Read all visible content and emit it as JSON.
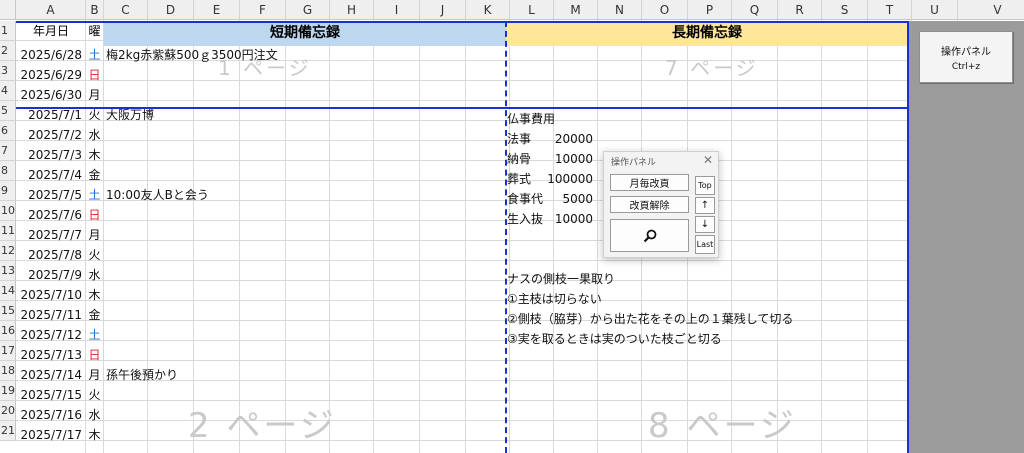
{
  "columns": [
    "A",
    "B",
    "C",
    "D",
    "E",
    "F",
    "G",
    "H",
    "I",
    "J",
    "K",
    "L",
    "M",
    "N",
    "O",
    "P",
    "Q",
    "R",
    "S",
    "T",
    "U",
    "V"
  ],
  "rows": [
    "1",
    "2",
    "3",
    "4",
    "5",
    "6",
    "7",
    "8",
    "9",
    "10",
    "11",
    "12",
    "13",
    "14",
    "15",
    "16",
    "17",
    "18",
    "19",
    "20",
    "21"
  ],
  "header": {
    "date_label": "年月日",
    "dow_label": "曜",
    "short_term_title": "短期備忘録",
    "long_term_title": "長期備忘録",
    "short_color": "#bdd7ee",
    "long_color": "#ffe699"
  },
  "days": [
    {
      "date": "2025/6/28",
      "dow": "土",
      "dow_color": "#1f6fd1",
      "memo": "梅2kg赤紫蘇500ｇ3500円注文"
    },
    {
      "date": "2025/6/29",
      "dow": "日",
      "dow_color": "#e0202a",
      "memo": ""
    },
    {
      "date": "2025/6/30",
      "dow": "月",
      "dow_color": "#111111",
      "memo": ""
    },
    {
      "date": "2025/7/1",
      "dow": "火",
      "dow_color": "#111111",
      "memo": "大阪万博"
    },
    {
      "date": "2025/7/2",
      "dow": "水",
      "dow_color": "#111111",
      "memo": ""
    },
    {
      "date": "2025/7/3",
      "dow": "木",
      "dow_color": "#111111",
      "memo": ""
    },
    {
      "date": "2025/7/4",
      "dow": "金",
      "dow_color": "#111111",
      "memo": ""
    },
    {
      "date": "2025/7/5",
      "dow": "土",
      "dow_color": "#1f6fd1",
      "memo": "10:00友人Bと会う"
    },
    {
      "date": "2025/7/6",
      "dow": "日",
      "dow_color": "#e0202a",
      "memo": ""
    },
    {
      "date": "2025/7/7",
      "dow": "月",
      "dow_color": "#111111",
      "memo": ""
    },
    {
      "date": "2025/7/8",
      "dow": "火",
      "dow_color": "#111111",
      "memo": ""
    },
    {
      "date": "2025/7/9",
      "dow": "水",
      "dow_color": "#111111",
      "memo": ""
    },
    {
      "date": "2025/7/10",
      "dow": "木",
      "dow_color": "#111111",
      "memo": ""
    },
    {
      "date": "2025/7/11",
      "dow": "金",
      "dow_color": "#111111",
      "memo": ""
    },
    {
      "date": "2025/7/12",
      "dow": "土",
      "dow_color": "#1f6fd1",
      "memo": ""
    },
    {
      "date": "2025/7/13",
      "dow": "日",
      "dow_color": "#e0202a",
      "memo": ""
    },
    {
      "date": "2025/7/14",
      "dow": "月",
      "dow_color": "#111111",
      "memo": "孫午後預かり"
    },
    {
      "date": "2025/7/15",
      "dow": "火",
      "dow_color": "#111111",
      "memo": ""
    },
    {
      "date": "2025/7/16",
      "dow": "水",
      "dow_color": "#111111",
      "memo": ""
    },
    {
      "date": "2025/7/17",
      "dow": "木",
      "dow_color": "#111111",
      "memo": ""
    }
  ],
  "long_term": {
    "memorial_title": "仏事費用",
    "expenses": [
      {
        "item": "法事",
        "amount": "20000"
      },
      {
        "item": "納骨",
        "amount": "10000"
      },
      {
        "item": "葬式",
        "amount": "100000"
      },
      {
        "item": "食事代",
        "amount": "5000"
      },
      {
        "item": "生入抜",
        "amount": "10000"
      }
    ],
    "notes": [
      "ナスの側枝一果取り",
      "①主枝は切らない",
      "②側枝（脇芽）から出た花をその上の１葉残して切る",
      "③実を取るときは実のついた枝ごと切る"
    ]
  },
  "watermarks": {
    "p1": "1 ページ",
    "p7": "7 ページ",
    "p2": "2 ページ",
    "p8": "8 ページ"
  },
  "panel_button": {
    "title": "操作パネル",
    "shortcut": "Ctrl+z"
  },
  "float_panel": {
    "title": "操作パネル",
    "btn_monthly": "月毎改頁",
    "btn_remove": "改頁解除",
    "btn_top": "Top",
    "btn_up": "↑",
    "btn_down": "↓",
    "btn_last": "Last",
    "search_icon": "search-icon",
    "close_icon": "close-icon"
  },
  "colors": {
    "border_blue": "#1a2fd6",
    "grid": "#d9d9d9",
    "watermark": "#c9c9c9"
  }
}
